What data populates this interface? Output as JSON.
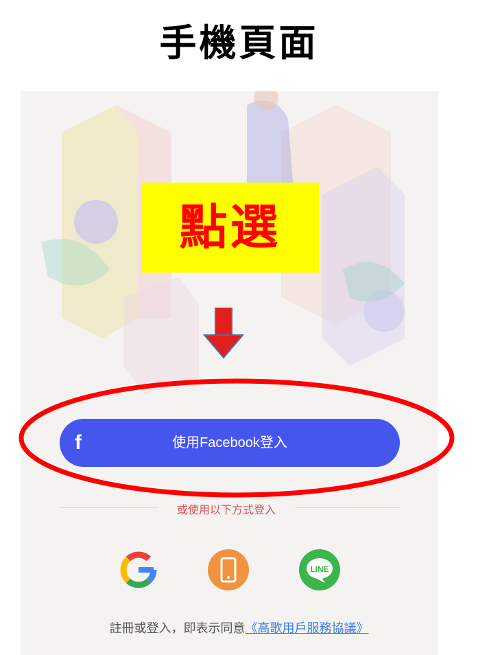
{
  "header": {
    "title": "手機頁面"
  },
  "callout": {
    "label": "點選"
  },
  "login": {
    "facebook_button": "使用Facebook登入",
    "facebook_icon": "f",
    "divider": "或使用以下方式登入",
    "social": [
      {
        "name": "google",
        "label": "G"
      },
      {
        "name": "phone",
        "label": ""
      },
      {
        "name": "line",
        "label": "LINE"
      }
    ]
  },
  "terms": {
    "prefix": "註冊或登入，即表示同意",
    "link": "《高歌用戶服務協議》"
  },
  "colors": {
    "facebook": "#4456ec",
    "callout_bg": "#ffff00",
    "callout_text": "#ff0000",
    "highlight": "#ff0000",
    "google_blue": "#4285f4",
    "phone_orange": "#f0923e",
    "line_green": "#3cb54a",
    "link": "#3b7be0"
  }
}
